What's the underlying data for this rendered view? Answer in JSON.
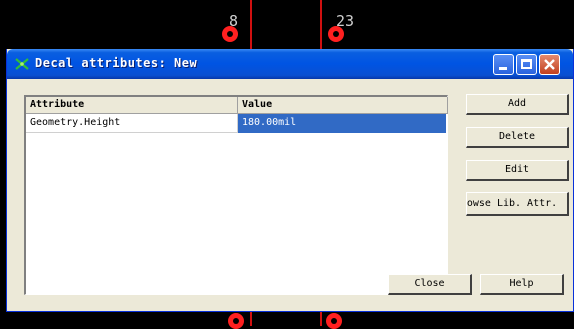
{
  "window": {
    "title": "Decal attributes: New",
    "controls": [
      "minimize",
      "maximize",
      "close"
    ]
  },
  "background": {
    "pad_labels": [
      "8",
      "23"
    ]
  },
  "table": {
    "columns": [
      "Attribute",
      "Value"
    ],
    "rows": [
      {
        "attribute": "Geometry.Height",
        "value": "180.00mil",
        "selected": true
      }
    ]
  },
  "buttons": {
    "add": "Add",
    "delete": "Delete",
    "edit": "Edit",
    "browse": "owse Lib. Attr.",
    "close": "Close",
    "help": "Help"
  },
  "colors": {
    "titlebar": "#0054e3",
    "dialog_face": "#ece9d8",
    "selection": "#316ac5",
    "pad": "#ff2020",
    "trace": "#d01010"
  }
}
